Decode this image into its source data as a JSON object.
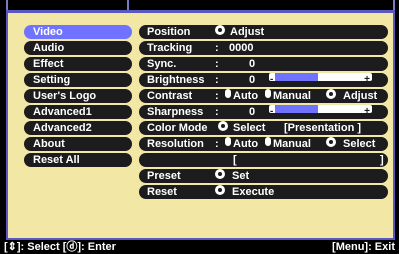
{
  "left_menu": [
    {
      "label": "Video",
      "selected": true
    },
    {
      "label": "Audio"
    },
    {
      "label": "Effect"
    },
    {
      "label": "Setting"
    },
    {
      "label": "User's Logo"
    },
    {
      "label": "Advanced1"
    },
    {
      "label": "Advanced2"
    },
    {
      "label": "About"
    },
    {
      "label": "Reset All"
    }
  ],
  "settings": {
    "position": {
      "label": "Position",
      "action": "Adjust"
    },
    "tracking": {
      "label": "Tracking",
      "colon": ":",
      "value": "0000"
    },
    "sync": {
      "label": "Sync.",
      "colon": ":",
      "value": "0"
    },
    "brightness": {
      "label": "Brightness",
      "colon": ":",
      "value": "0",
      "minus": "-",
      "plus": "+",
      "level": 0.42
    },
    "contrast": {
      "label": "Contrast",
      "colon": ":",
      "opt1": "Auto",
      "opt2": "Manual",
      "action": "Adjust"
    },
    "sharpness": {
      "label": "Sharpness",
      "colon": ":",
      "value": "0",
      "minus": "-",
      "plus": "+",
      "level": 0.42
    },
    "color_mode": {
      "label": "Color Mode",
      "action": "Select",
      "value": "[Presentation   ]"
    },
    "resolution": {
      "label": "Resolution",
      "colon": ":",
      "opt1": "Auto",
      "opt2": "Manual",
      "action": "Select"
    },
    "resolution_value": {
      "open": "[",
      "close": "]"
    },
    "preset": {
      "label": "Preset",
      "action": "Set"
    },
    "reset": {
      "label": "Reset",
      "action": "Execute"
    }
  },
  "footer": {
    "left": "[⇕]: Select  [ⓓ]: Enter",
    "right": "[Menu]: Exit"
  }
}
